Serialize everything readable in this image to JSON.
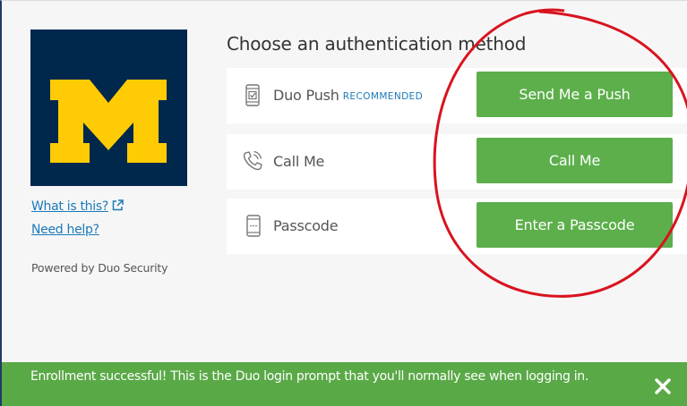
{
  "heading": "Choose an authentication method",
  "sidebar": {
    "what_is_this": "What is this?",
    "need_help": "Need help?",
    "powered_by": "Powered by Duo Security"
  },
  "methods": [
    {
      "label": "Duo Push",
      "badge": "RECOMMENDED",
      "button": "Send Me a Push",
      "icon": "phone-check-icon"
    },
    {
      "label": "Call Me",
      "badge": "",
      "button": "Call Me",
      "icon": "phone-call-icon"
    },
    {
      "label": "Passcode",
      "badge": "",
      "button": "Enter a Passcode",
      "icon": "passcode-device-icon"
    }
  ],
  "banner": {
    "message": "Enrollment successful! This is the Duo login prompt that you'll normally see when logging in.",
    "close_icon": "close-icon"
  },
  "colors": {
    "logo_background": "#00274c",
    "logo_maize": "#ffcb05",
    "button_green": "#5caf4a",
    "banner_green": "#5aa947",
    "link_blue": "#1b79b8",
    "annotation_red": "#d9131f"
  }
}
